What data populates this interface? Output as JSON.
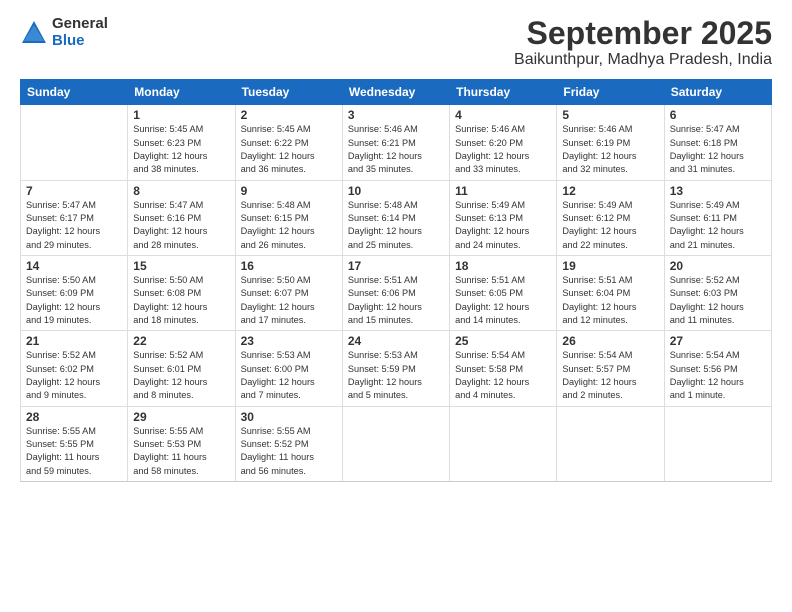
{
  "header": {
    "logo_general": "General",
    "logo_blue": "Blue",
    "month": "September 2025",
    "location": "Baikunthpur, Madhya Pradesh, India"
  },
  "weekdays": [
    "Sunday",
    "Monday",
    "Tuesday",
    "Wednesday",
    "Thursday",
    "Friday",
    "Saturday"
  ],
  "weeks": [
    [
      {
        "day": "",
        "info": ""
      },
      {
        "day": "1",
        "info": "Sunrise: 5:45 AM\nSunset: 6:23 PM\nDaylight: 12 hours\nand 38 minutes."
      },
      {
        "day": "2",
        "info": "Sunrise: 5:45 AM\nSunset: 6:22 PM\nDaylight: 12 hours\nand 36 minutes."
      },
      {
        "day": "3",
        "info": "Sunrise: 5:46 AM\nSunset: 6:21 PM\nDaylight: 12 hours\nand 35 minutes."
      },
      {
        "day": "4",
        "info": "Sunrise: 5:46 AM\nSunset: 6:20 PM\nDaylight: 12 hours\nand 33 minutes."
      },
      {
        "day": "5",
        "info": "Sunrise: 5:46 AM\nSunset: 6:19 PM\nDaylight: 12 hours\nand 32 minutes."
      },
      {
        "day": "6",
        "info": "Sunrise: 5:47 AM\nSunset: 6:18 PM\nDaylight: 12 hours\nand 31 minutes."
      }
    ],
    [
      {
        "day": "7",
        "info": "Sunrise: 5:47 AM\nSunset: 6:17 PM\nDaylight: 12 hours\nand 29 minutes."
      },
      {
        "day": "8",
        "info": "Sunrise: 5:47 AM\nSunset: 6:16 PM\nDaylight: 12 hours\nand 28 minutes."
      },
      {
        "day": "9",
        "info": "Sunrise: 5:48 AM\nSunset: 6:15 PM\nDaylight: 12 hours\nand 26 minutes."
      },
      {
        "day": "10",
        "info": "Sunrise: 5:48 AM\nSunset: 6:14 PM\nDaylight: 12 hours\nand 25 minutes."
      },
      {
        "day": "11",
        "info": "Sunrise: 5:49 AM\nSunset: 6:13 PM\nDaylight: 12 hours\nand 24 minutes."
      },
      {
        "day": "12",
        "info": "Sunrise: 5:49 AM\nSunset: 6:12 PM\nDaylight: 12 hours\nand 22 minutes."
      },
      {
        "day": "13",
        "info": "Sunrise: 5:49 AM\nSunset: 6:11 PM\nDaylight: 12 hours\nand 21 minutes."
      }
    ],
    [
      {
        "day": "14",
        "info": "Sunrise: 5:50 AM\nSunset: 6:09 PM\nDaylight: 12 hours\nand 19 minutes."
      },
      {
        "day": "15",
        "info": "Sunrise: 5:50 AM\nSunset: 6:08 PM\nDaylight: 12 hours\nand 18 minutes."
      },
      {
        "day": "16",
        "info": "Sunrise: 5:50 AM\nSunset: 6:07 PM\nDaylight: 12 hours\nand 17 minutes."
      },
      {
        "day": "17",
        "info": "Sunrise: 5:51 AM\nSunset: 6:06 PM\nDaylight: 12 hours\nand 15 minutes."
      },
      {
        "day": "18",
        "info": "Sunrise: 5:51 AM\nSunset: 6:05 PM\nDaylight: 12 hours\nand 14 minutes."
      },
      {
        "day": "19",
        "info": "Sunrise: 5:51 AM\nSunset: 6:04 PM\nDaylight: 12 hours\nand 12 minutes."
      },
      {
        "day": "20",
        "info": "Sunrise: 5:52 AM\nSunset: 6:03 PM\nDaylight: 12 hours\nand 11 minutes."
      }
    ],
    [
      {
        "day": "21",
        "info": "Sunrise: 5:52 AM\nSunset: 6:02 PM\nDaylight: 12 hours\nand 9 minutes."
      },
      {
        "day": "22",
        "info": "Sunrise: 5:52 AM\nSunset: 6:01 PM\nDaylight: 12 hours\nand 8 minutes."
      },
      {
        "day": "23",
        "info": "Sunrise: 5:53 AM\nSunset: 6:00 PM\nDaylight: 12 hours\nand 7 minutes."
      },
      {
        "day": "24",
        "info": "Sunrise: 5:53 AM\nSunset: 5:59 PM\nDaylight: 12 hours\nand 5 minutes."
      },
      {
        "day": "25",
        "info": "Sunrise: 5:54 AM\nSunset: 5:58 PM\nDaylight: 12 hours\nand 4 minutes."
      },
      {
        "day": "26",
        "info": "Sunrise: 5:54 AM\nSunset: 5:57 PM\nDaylight: 12 hours\nand 2 minutes."
      },
      {
        "day": "27",
        "info": "Sunrise: 5:54 AM\nSunset: 5:56 PM\nDaylight: 12 hours\nand 1 minute."
      }
    ],
    [
      {
        "day": "28",
        "info": "Sunrise: 5:55 AM\nSunset: 5:55 PM\nDaylight: 11 hours\nand 59 minutes."
      },
      {
        "day": "29",
        "info": "Sunrise: 5:55 AM\nSunset: 5:53 PM\nDaylight: 11 hours\nand 58 minutes."
      },
      {
        "day": "30",
        "info": "Sunrise: 5:55 AM\nSunset: 5:52 PM\nDaylight: 11 hours\nand 56 minutes."
      },
      {
        "day": "",
        "info": ""
      },
      {
        "day": "",
        "info": ""
      },
      {
        "day": "",
        "info": ""
      },
      {
        "day": "",
        "info": ""
      }
    ]
  ]
}
